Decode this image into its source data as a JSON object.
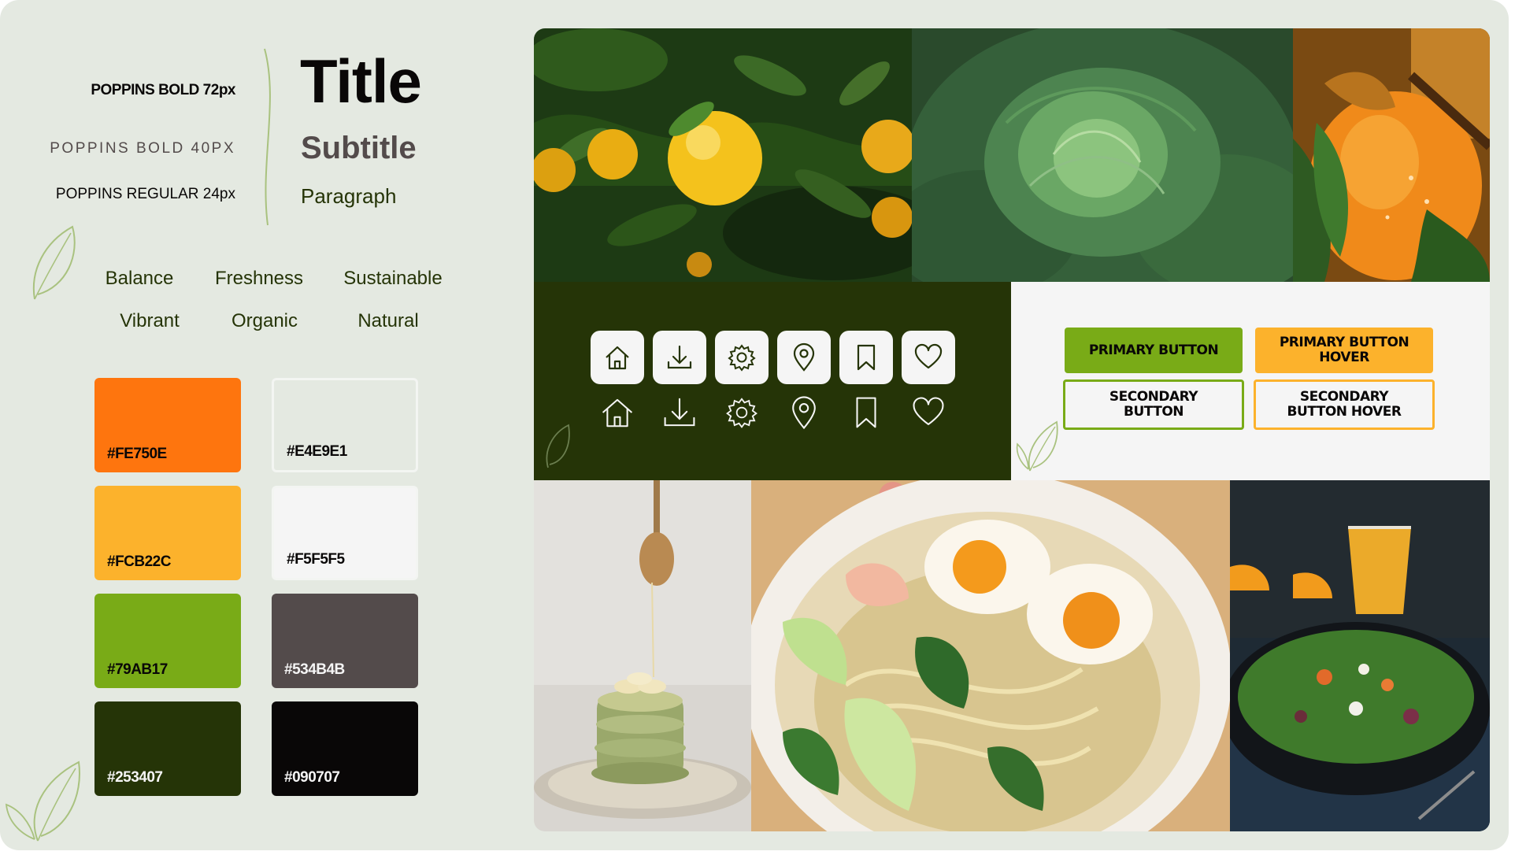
{
  "typography": {
    "spec_title": "POPPINS BOLD 72px",
    "spec_subtitle": "POPPINS BOLD 40PX",
    "spec_paragraph": "POPPINS REGULAR 24px",
    "sample_title": "Title",
    "sample_subtitle": "Subtitle",
    "sample_paragraph": "Paragraph"
  },
  "keywords": [
    "Balance",
    "Freshness",
    "Sustainable",
    "Vibrant",
    "Organic",
    "Natural"
  ],
  "palette": [
    {
      "hex": "#FE750E",
      "color": "#fe750e",
      "text_color": "#090707"
    },
    {
      "hex": "#E4E9E1",
      "color": "#e4e9e1",
      "text_color": "#090707"
    },
    {
      "hex": "#FCB22C",
      "color": "#fcb22c",
      "text_color": "#090707"
    },
    {
      "hex": "#F5F5F5",
      "color": "#f5f5f5",
      "text_color": "#090707"
    },
    {
      "hex": "#79AB17",
      "color": "#79ab17",
      "text_color": "#090707"
    },
    {
      "hex": "#534B4B",
      "color": "#534b4b",
      "text_color": "#f5f5f5"
    },
    {
      "hex": "#253407",
      "color": "#253407",
      "text_color": "#f5f5f5"
    },
    {
      "hex": "#090707",
      "color": "#090707",
      "text_color": "#f5f5f5"
    }
  ],
  "icons": [
    "home-icon",
    "download-icon",
    "settings-icon",
    "location-icon",
    "bookmark-icon",
    "heart-icon"
  ],
  "buttons": {
    "primary": "PRIMARY BUTTON",
    "primary_hover": "PRIMARY BUTTON HOVER",
    "secondary": "SECONDARY BUTTON",
    "secondary_hover": "SECONDARY BUTTON HOVER"
  },
  "photos": [
    "lemon-tree-photo",
    "cabbage-photo",
    "persimmon-photo",
    "pancakes-photo",
    "ramen-photo",
    "salad-photo"
  ],
  "colors": {
    "background": "#e4e9e1",
    "primary_green": "#79ab17",
    "dark_green": "#253407",
    "orange": "#fe750e",
    "yellow": "#fcb22c"
  }
}
